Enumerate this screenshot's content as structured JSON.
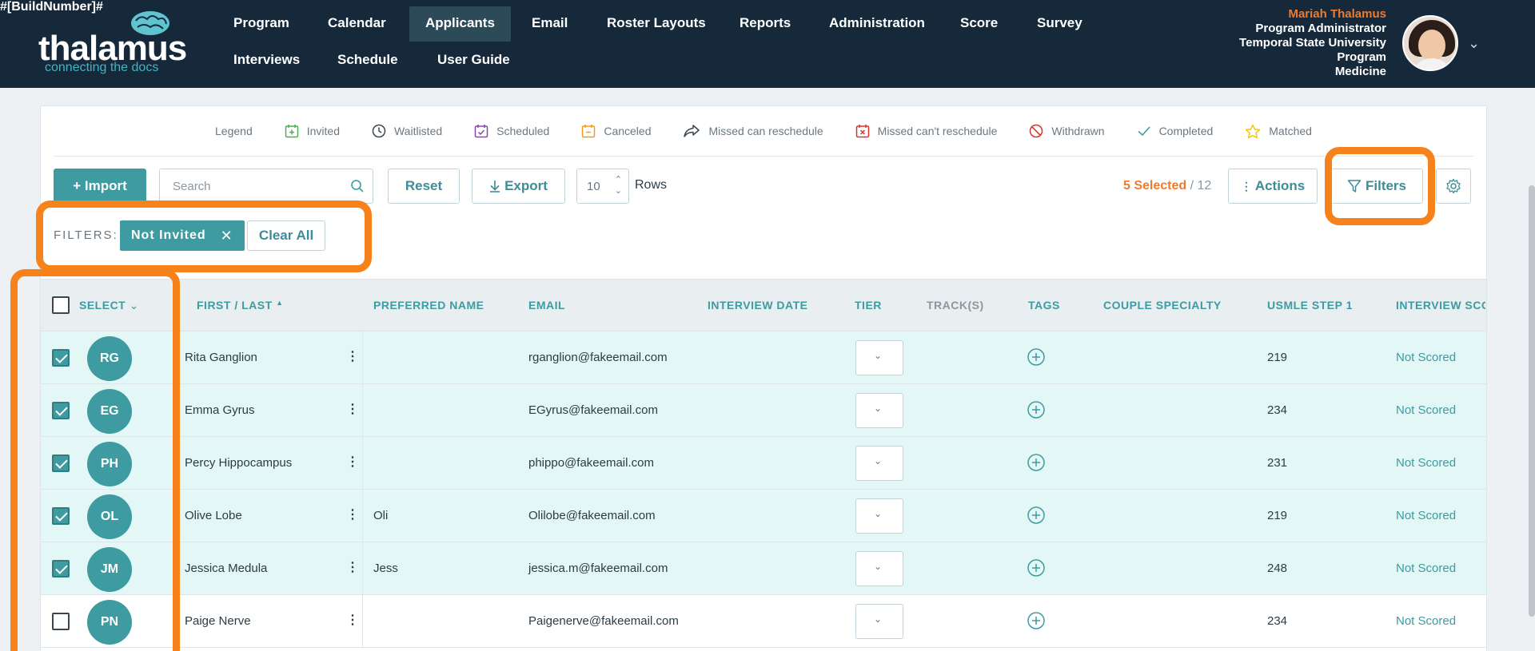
{
  "build_number": "#[BuildNumber]#",
  "logo": {
    "wordmark": "thalamus",
    "tagline": "connecting the docs"
  },
  "nav": {
    "items_row1": [
      "Program",
      "Calendar",
      "Applicants",
      "Email",
      "Roster Layouts",
      "Reports",
      "Administration",
      "Score",
      "Survey"
    ],
    "items_row2": [
      "Interviews",
      "Schedule",
      "User Guide"
    ],
    "active": "Applicants"
  },
  "user": {
    "name": "Mariah Thalamus",
    "role": "Program Administrator",
    "institution": "Temporal State University",
    "program_line": "Program",
    "specialty": "Medicine"
  },
  "legend": {
    "title": "Legend",
    "items": [
      "Invited",
      "Waitlisted",
      "Scheduled",
      "Canceled",
      "Missed can reschedule",
      "Missed can't reschedule",
      "Withdrawn",
      "Completed",
      "Matched"
    ]
  },
  "toolbar": {
    "import_label": "+ Import",
    "search_placeholder": "Search",
    "reset_label": "Reset",
    "export_label": "Export",
    "rows_value": "10",
    "rows_label": "Rows",
    "selected_label": "5 Selected",
    "total_label": " / 12",
    "actions_label": "Actions",
    "filters_label": "Filters"
  },
  "filters": {
    "label": "FILTERS:",
    "chip": "Not Invited",
    "clear_all": "Clear All"
  },
  "table": {
    "columns": [
      "SELECT",
      "FIRST / LAST",
      "PREFERRED NAME",
      "EMAIL",
      "INTERVIEW DATE",
      "TIER",
      "TRACK(S)",
      "TAGS",
      "COUPLE SPECIALTY",
      "USMLE STEP 1",
      "INTERVIEW SCO"
    ],
    "rows": [
      {
        "initials": "RG",
        "name": "Rita Ganglion",
        "preferred": "",
        "email": "rganglion@fakeemail.com",
        "usmle": "219",
        "score": "Not Scored",
        "selected": true
      },
      {
        "initials": "EG",
        "name": "Emma Gyrus",
        "preferred": "",
        "email": "EGyrus@fakeemail.com",
        "usmle": "234",
        "score": "Not Scored",
        "selected": true
      },
      {
        "initials": "PH",
        "name": "Percy Hippocampus",
        "preferred": "",
        "email": "phippo@fakeemail.com",
        "usmle": "231",
        "score": "Not Scored",
        "selected": true
      },
      {
        "initials": "OL",
        "name": "Olive Lobe",
        "preferred": "Oli",
        "email": "Olilobe@fakeemail.com",
        "usmle": "219",
        "score": "Not Scored",
        "selected": true
      },
      {
        "initials": "JM",
        "name": "Jessica Medula",
        "preferred": "Jess",
        "email": "jessica.m@fakeemail.com",
        "usmle": "248",
        "score": "Not Scored",
        "selected": true
      },
      {
        "initials": "PN",
        "name": "Paige Nerve",
        "preferred": "",
        "email": "Paigenerve@fakeemail.com",
        "usmle": "234",
        "score": "Not Scored",
        "selected": false
      }
    ]
  },
  "colors": {
    "header": "#15293a",
    "accent": "#3d9ba1",
    "orange": "#f07a2c",
    "highlight": "#f7821b",
    "row_selected": "#e3f7f7"
  }
}
